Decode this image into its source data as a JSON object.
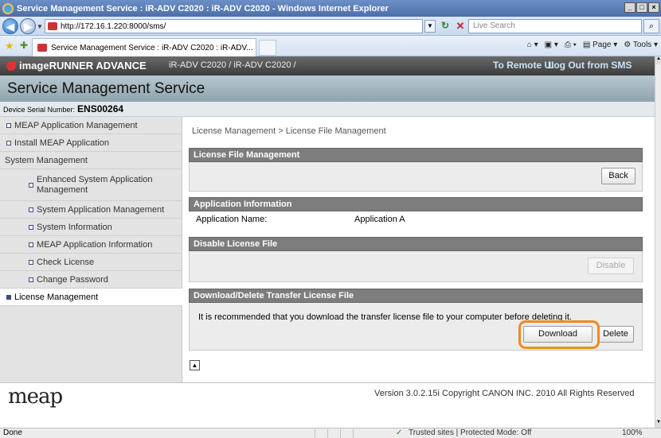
{
  "browser": {
    "window_title": "Service Management Service : iR-ADV C2020 : iR-ADV C2020 - Windows Internet Explorer",
    "address": "http://172.16.1.220:8000/sms/",
    "search_placeholder": "Live Search",
    "tab_title": "Service Management Service : iR-ADV C2020 : iR-ADV...",
    "commands": {
      "page": "Page",
      "tools": "Tools"
    },
    "status_left": "Done",
    "status_zone": "Trusted sites | Protected Mode: Off",
    "zoom": "100%"
  },
  "header": {
    "brand": "imageRUNNER ADVANCE",
    "model": "iR-ADV C2020 / iR-ADV C2020 /",
    "remote_ui_link": "To Remote UI",
    "logout_link": "Log Out from SMS",
    "app_title": "Service Management Service",
    "serial_label": "Device Serial Number:",
    "serial_value": "ENS00264"
  },
  "sidebar": {
    "items": [
      {
        "label": "MEAP Application Management"
      },
      {
        "label": "Install MEAP Application"
      },
      {
        "label": "System Management"
      },
      {
        "label": "Enhanced System Application Management"
      },
      {
        "label": "System Application Management"
      },
      {
        "label": "System Information"
      },
      {
        "label": "MEAP Application Information"
      },
      {
        "label": "Check License"
      },
      {
        "label": "Change Password"
      },
      {
        "label": "License Management"
      }
    ]
  },
  "main": {
    "breadcrumb": "License Management > License File Management",
    "license_file_mgmt": {
      "title": "License File Management",
      "back_label": "Back"
    },
    "app_info": {
      "title": "Application Information",
      "name_label": "Application Name:",
      "name_value": "Application A"
    },
    "disable_section": {
      "title": "Disable License File",
      "disable_label": "Disable"
    },
    "download_section": {
      "title": "Download/Delete Transfer License File",
      "message": "It is recommended that you download the transfer license file to your computer before deleting it.",
      "download_label": "Download",
      "delete_label": "Delete"
    }
  },
  "footer": {
    "logo": "meap",
    "copyright": "Version 3.0.2.15i Copyright CANON INC. 2010 All Rights Reserved"
  },
  "colors": {
    "highlight": "#f08a1c",
    "section_header": "#7d7d7d",
    "sms_title_bg": "#a6b7c0"
  }
}
